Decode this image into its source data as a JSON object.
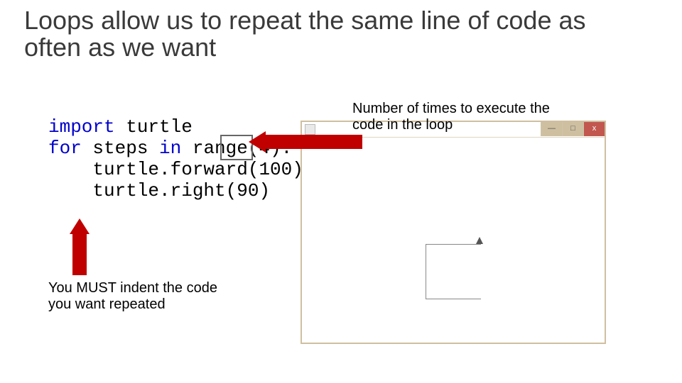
{
  "title": "Loops allow us to repeat the same line of code as often as we want",
  "code": {
    "line1_kw": "import",
    "line1_rest": " turtle",
    "line2_kw1": "for",
    "line2_mid": " steps ",
    "line2_kw2": "in",
    "line2_rest": " range(4):",
    "line3": "    turtle.forward(100)",
    "line4": "    turtle.right(90)"
  },
  "annotations": {
    "top": "Number of times to execute the code in the loop",
    "bottom": "You MUST indent the code you want repeated"
  },
  "window": {
    "min": "—",
    "max": "□",
    "close": "x"
  }
}
